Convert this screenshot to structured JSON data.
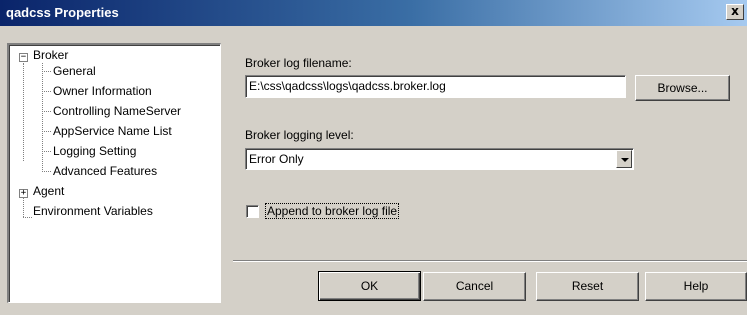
{
  "window": {
    "title": "qadcss Properties",
    "close_glyph": "x"
  },
  "tree": {
    "broker": {
      "label": "Broker",
      "expander": "−",
      "children": [
        "General",
        "Owner Information",
        "Controlling NameServer",
        "AppService Name List",
        "Logging Setting",
        "Advanced Features"
      ]
    },
    "agent": {
      "label": "Agent",
      "expander": "+"
    },
    "environment": {
      "label": "Environment Variables"
    }
  },
  "form": {
    "log_filename_label": "Broker log filename:",
    "log_filename_value": "E:\\css\\qadcss\\logs\\qadcss.broker.log",
    "browse_label": "Browse...",
    "logging_level_label": "Broker logging level:",
    "logging_level_value": "Error Only",
    "append_label": "Append to broker log file",
    "append_checked": false
  },
  "buttons": {
    "ok": "OK",
    "cancel": "Cancel",
    "reset": "Reset",
    "help": "Help"
  },
  "icons": {
    "close": "close-icon",
    "dropdown": "chevron-down-icon"
  }
}
